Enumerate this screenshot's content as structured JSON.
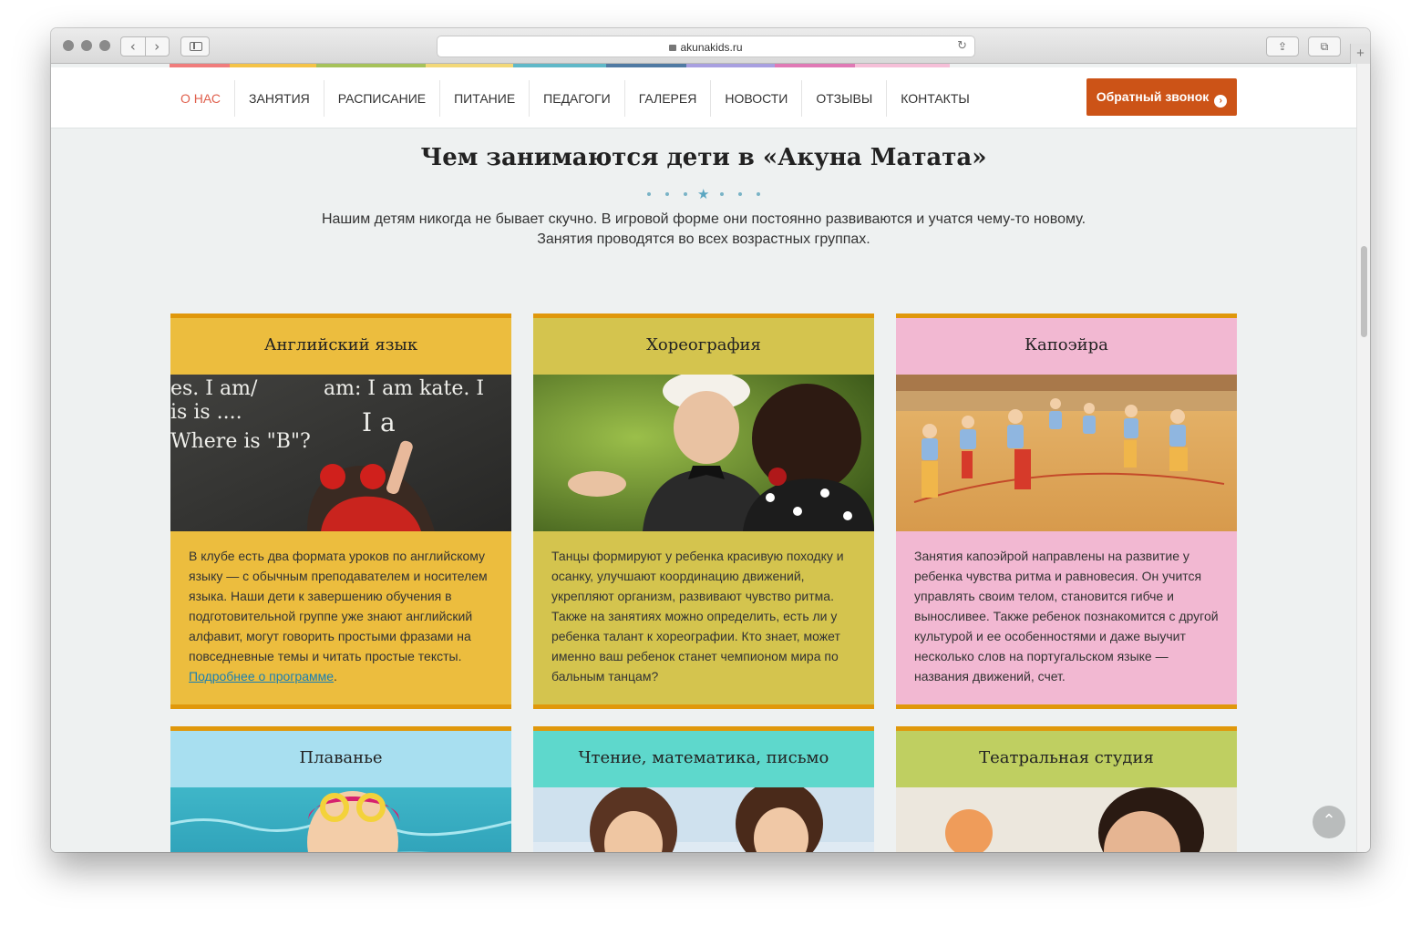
{
  "browser": {
    "url": "akunakids.ru",
    "back_icon": "‹",
    "forward_icon": "›",
    "reload_icon": "↻",
    "share_icon": "⇪",
    "tabs_icon": "⧉",
    "plus_icon": "+"
  },
  "colorbar": [
    "#f07c7c",
    "#f4c347",
    "#a6c25a",
    "#f2d878",
    "#5fb8c8",
    "#507aa3",
    "#a89fe0",
    "#e079b5",
    "#f6bfd8"
  ],
  "nav": {
    "items": [
      "О НАС",
      "ЗАНЯТИЯ",
      "РАСПИСАНИЕ",
      "ПИТАНИЕ",
      "ПЕДАГОГИ",
      "ГАЛЕРЕЯ",
      "НОВОСТИ",
      "ОТЗЫВЫ",
      "КОНТАКТЫ"
    ],
    "active_color": "#e0604d",
    "callback_label": "Обратный звонок",
    "callback_color": "#cc5317"
  },
  "section": {
    "title": "Чем занимаются дети в «Акуна Матата»",
    "intro_line1": "Нашим детям никогда не бывает скучно. В игровой форме они постоянно развиваются и учатся чему-то новому.",
    "intro_line2": "Занятия проводятся во всех возрастных группах."
  },
  "cards": [
    {
      "title": "Английский язык",
      "color": "#ecbd3e",
      "body": "В клубе есть два формата уроков по английскому языку — с обычным преподавателем и носителем языка. Наши дети к завершению обучения в подготовительной группе уже знают английский алфавит, могут говорить простыми фразами на повседневные темы и читать простые тексты.",
      "link": "Подробнее о программе",
      "link_suffix": ".",
      "chalk_lines": [
        "es. I am/",
        "am: I am kate. I",
        "is is ....",
        "I a",
        "Where is \"B\"?"
      ]
    },
    {
      "title": "Хореография",
      "color": "#d4c44e",
      "body": "Танцы формируют у ребенка красивую походку и осанку, улучшают координацию движений, укрепляют организм, развивают чувство ритма. Также на занятиях можно определить, есть ли у ребенка талант к хореографии. Кто знает, может именно ваш ребенок станет чемпионом мира по бальным танцам?"
    },
    {
      "title": "Капоэйра",
      "color": "#f2b8d2",
      "body": "Занятия капоэйрой направлены на развитие у ребенка чувства ритма и равновесия. Он учится управлять своим телом, становится гибче и выносливее. Также ребенок познакомится с другой культурой и ее особенностями и даже выучит несколько слов на португальском языке — названия движений, счет."
    },
    {
      "title": "Плаванье",
      "color": "#a8dff0"
    },
    {
      "title": "Чтение, математика, письмо",
      "color": "#5ed8cc"
    },
    {
      "title": "Театральная студия",
      "color": "#bfcf61"
    }
  ],
  "to_top_icon": "⌃"
}
